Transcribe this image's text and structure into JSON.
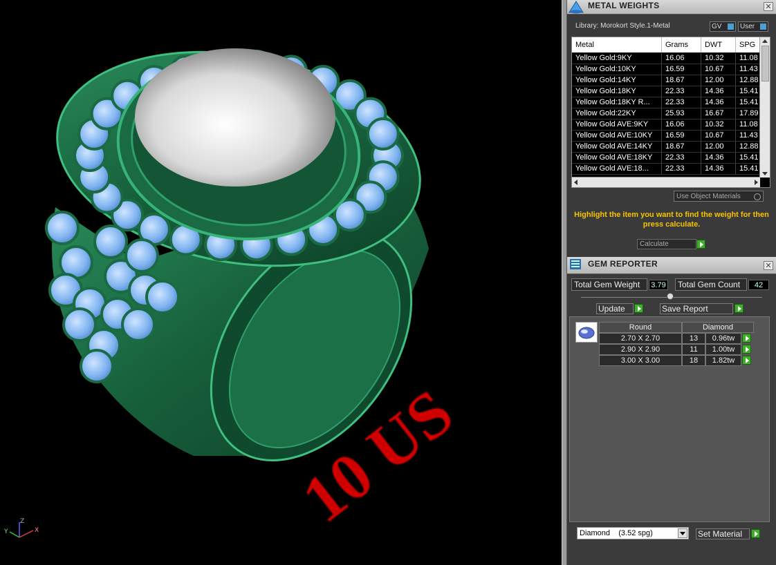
{
  "viewport": {
    "ring_label": "10 US",
    "axis_z": "Z",
    "axis_x": "X",
    "axis_y": "Y"
  },
  "metal_weights": {
    "title": "METAL WEIGHTS",
    "library_label": "Library: Morokort Style.1-Metal",
    "gv_label": "GV",
    "user_label": "User",
    "columns": [
      "Metal",
      "Grams",
      "DWT",
      "SPG"
    ],
    "rows": [
      [
        "Yellow Gold:9KY",
        "16.06",
        "10.32",
        "11.08"
      ],
      [
        "Yellow Gold:10KY",
        "16.59",
        "10.67",
        "11.43"
      ],
      [
        "Yellow Gold:14KY",
        "18.67",
        "12.00",
        "12.88"
      ],
      [
        "Yellow Gold:18KY",
        "22.33",
        "14.36",
        "15.41"
      ],
      [
        "Yellow Gold:18KY R...",
        "22.33",
        "14.36",
        "15.41"
      ],
      [
        "Yellow Gold:22KY",
        "25.93",
        "16.67",
        "17.89"
      ],
      [
        "Yellow Gold AVE:9KY",
        "16.06",
        "10.32",
        "11.08"
      ],
      [
        "Yellow Gold AVE:10KY",
        "16.59",
        "10.67",
        "11.43"
      ],
      [
        "Yellow Gold AVE:14KY",
        "18.67",
        "12.00",
        "12.88"
      ],
      [
        "Yellow Gold AVE:18KY",
        "22.33",
        "14.36",
        "15.41"
      ],
      [
        "Yellow Gold AVE:18...",
        "22.33",
        "14.36",
        "15.41"
      ]
    ],
    "use_object_materials": "Use Object Materials",
    "hint": "Highlight the item you want to find the weight for then press calculate.",
    "calculate_label": "Calculate"
  },
  "gem_reporter": {
    "title": "GEM REPORTER",
    "total_weight_label": "Total Gem Weight",
    "total_weight_value": "3.79",
    "total_count_label": "Total Gem Count",
    "total_count_value": "42",
    "update_label": "Update",
    "save_report_label": "Save Report",
    "shape_header": "Round",
    "type_header": "Diamond",
    "rows": [
      {
        "size": "2.70 X 2.70",
        "count": "13",
        "weight": "0.96tw"
      },
      {
        "size": "2.90 X 2.90",
        "count": "11",
        "weight": "1.00tw"
      },
      {
        "size": "3.00 X 3.00",
        "count": "18",
        "weight": "1.82tw"
      }
    ],
    "material_select": "Diamond    (3.52 spg)",
    "set_material_label": "Set Material"
  },
  "colors": {
    "metal": "#1e7a4e",
    "gem": "#7fb4f0",
    "pearl": "#e8e8e8",
    "label": "#d00000",
    "hint": "#f5c400"
  }
}
